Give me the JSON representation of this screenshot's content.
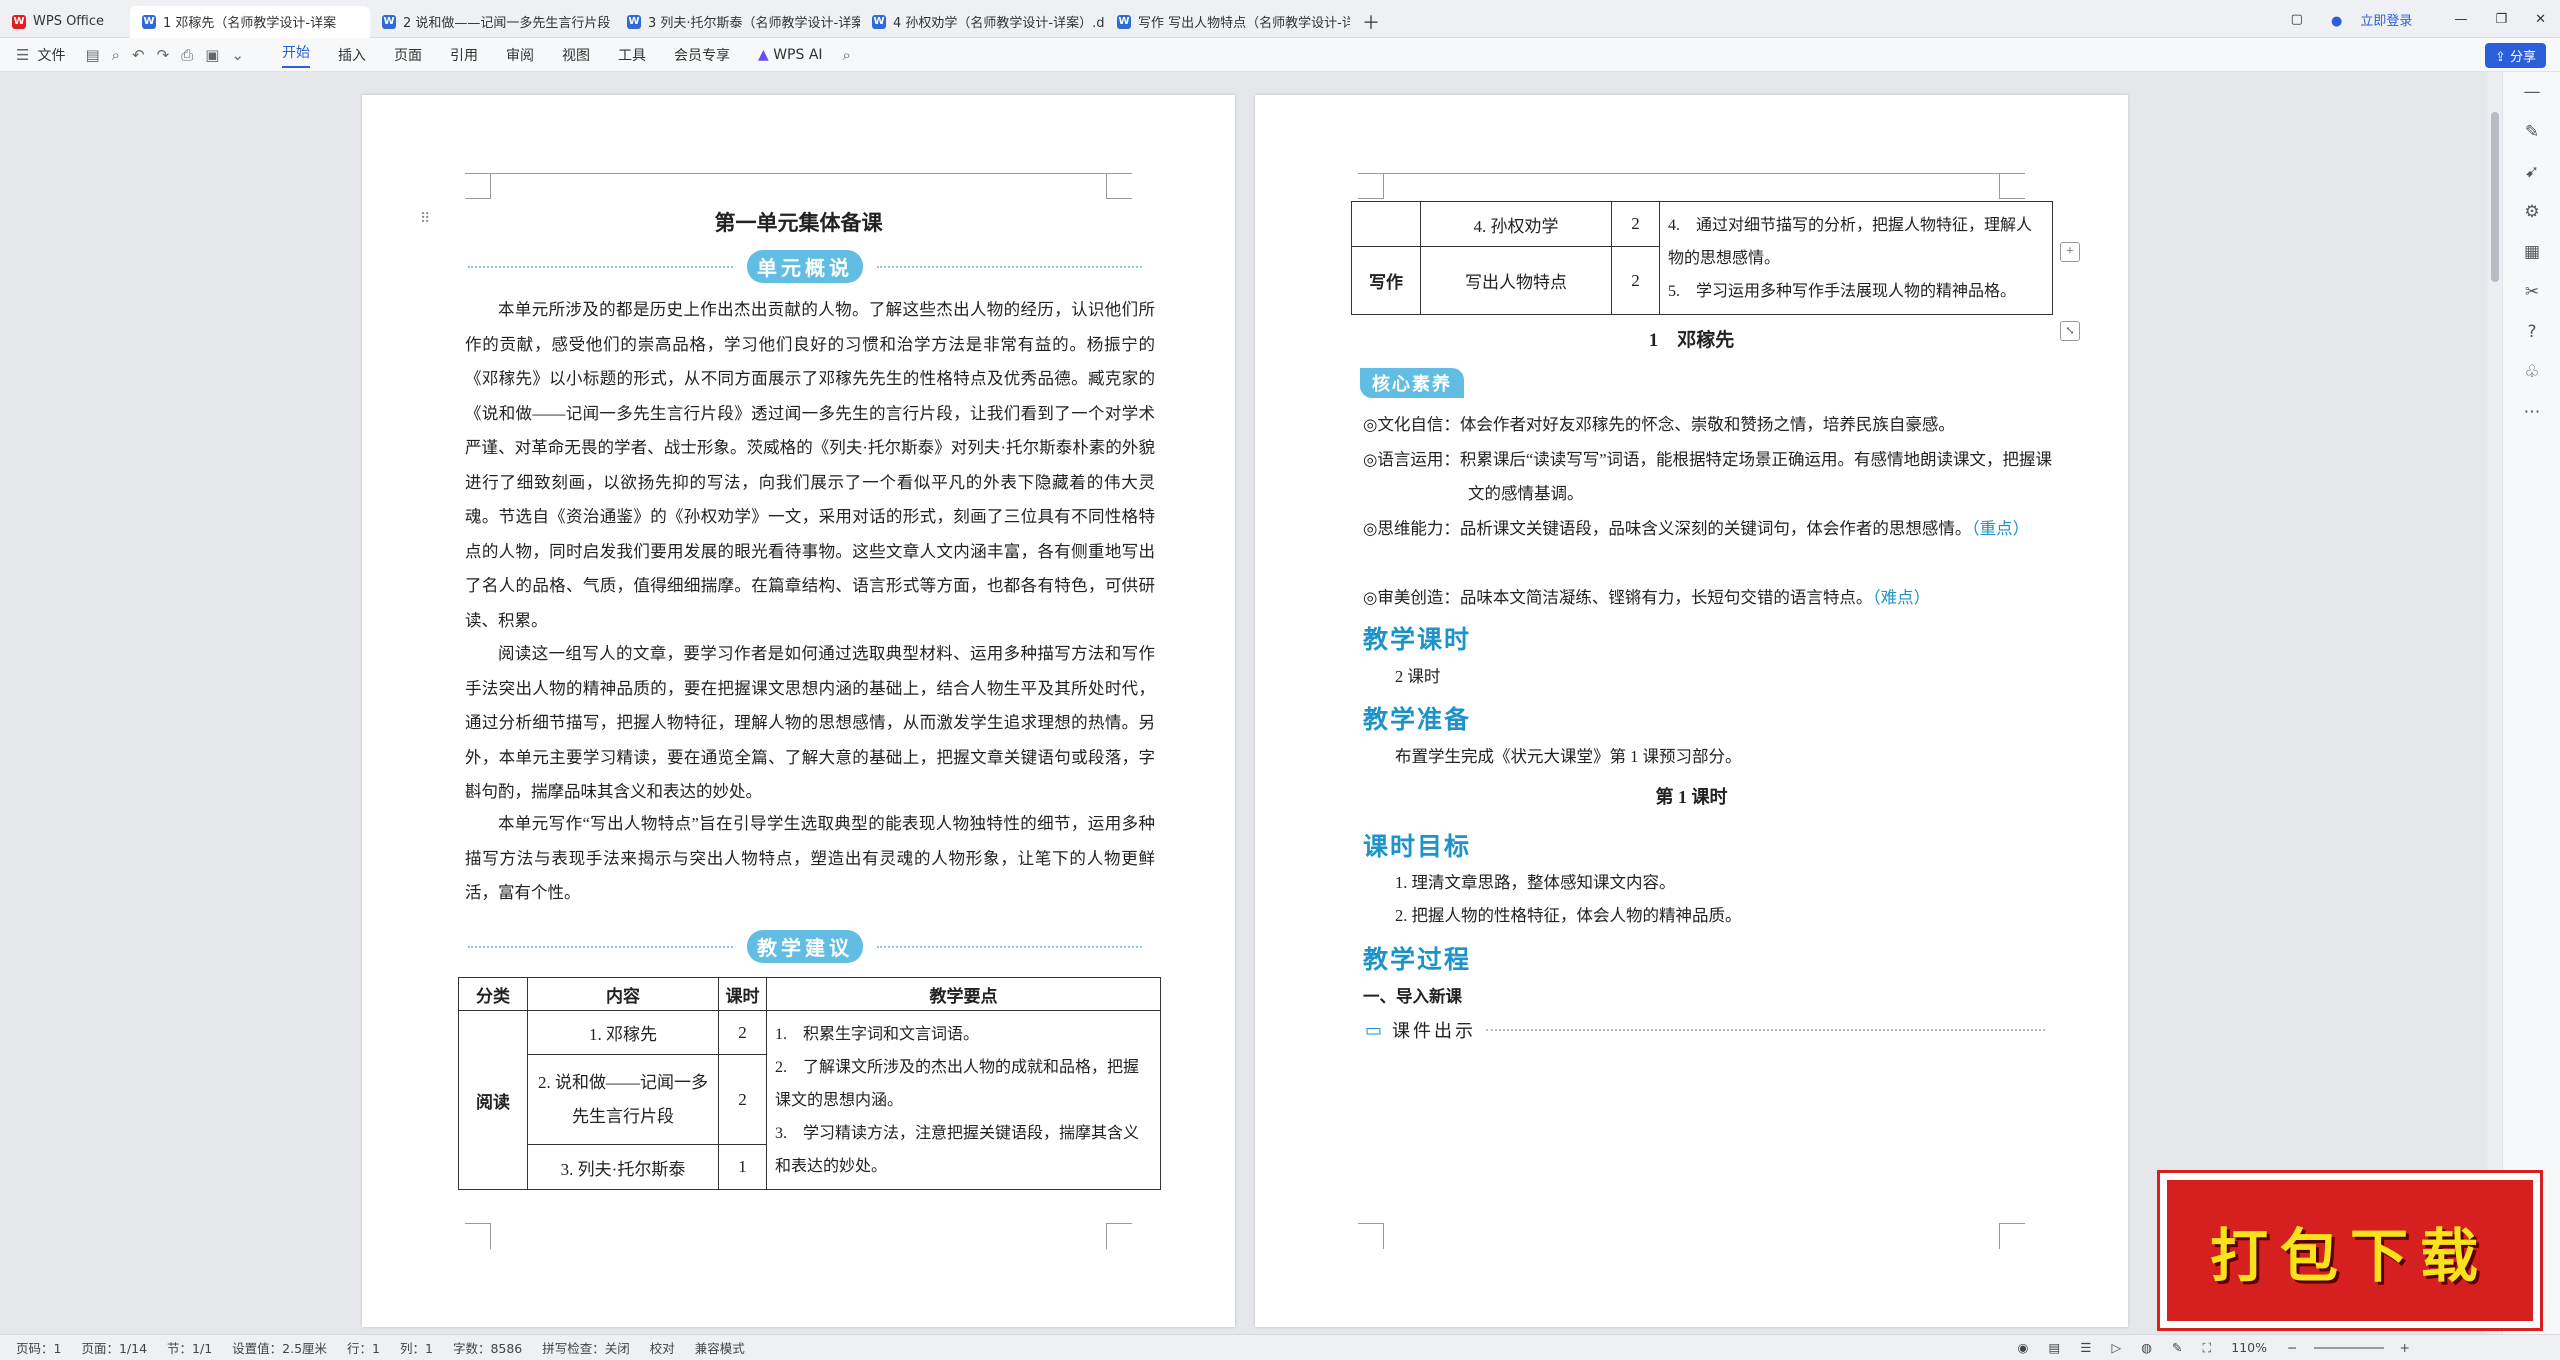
{
  "titlebar": {
    "tabs": [
      {
        "icon": "wps",
        "label": "WPS Office"
      },
      {
        "icon": "w",
        "label": "1 邓稼先（名师教学设计-详案"
      },
      {
        "icon": "w",
        "label": "2 说和做——记闻一多先生言行片段"
      },
      {
        "icon": "w",
        "label": "3 列夫·托尔斯泰（名师教学设计-详案）"
      },
      {
        "icon": "w",
        "label": "4 孙权劝学（名师教学设计-详案）.do"
      },
      {
        "icon": "w",
        "label": "写作 写出人物特点（名师教学设计-详"
      }
    ],
    "login": "立即登录"
  },
  "ribbon": {
    "file": "文件",
    "menus": [
      "开始",
      "插入",
      "页面",
      "引用",
      "审阅",
      "视图",
      "工具",
      "会员专享"
    ],
    "ai": "WPS AI",
    "share": "分享"
  },
  "left_page": {
    "title": "第一单元集体备课",
    "overview_head": "单元概说",
    "paragraphs": [
      "本单元所涉及的都是历史上作出杰出贡献的人物。了解这些杰出人物的经历，认识他们所作的贡献，感受他们的崇高品格，学习他们良好的习惯和治学方法是非常有益的。杨振宁的《邓稼先》以小标题的形式，从不同方面展示了邓稼先先生的性格特点及优秀品德。臧克家的《说和做——记闻一多先生言行片段》透过闻一多先生的言行片段，让我们看到了一个对学术严谨、对革命无畏的学者、战士形象。茨威格的《列夫·托尔斯泰》对列夫·托尔斯泰朴素的外貌进行了细致刻画，以欲扬先抑的写法，向我们展示了一个看似平凡的外表下隐藏着的伟大灵魂。节选自《资治通鉴》的《孙权劝学》一文，采用对话的形式，刻画了三位具有不同性格特点的人物，同时启发我们要用发展的眼光看待事物。这些文章人文内涵丰富，各有侧重地写出了名人的品格、气质，值得细细揣摩。在篇章结构、语言形式等方面，也都各有特色，可供研读、积累。",
      "阅读这一组写人的文章，要学习作者是如何通过选取典型材料、运用多种描写方法和写作手法突出人物的精神品质的，要在把握课文思想内涵的基础上，结合人物生平及其所处时代，通过分析细节描写，把握人物特征，理解人物的思想感情，从而激发学生追求理想的热情。另外，本单元主要学习精读，要在通览全篇、了解大意的基础上，把握文章关键语句或段落，字斟句酌，揣摩品味其含义和表达的妙处。",
      "本单元写作“写出人物特点”旨在引导学生选取典型的能表现人物独特性的细节，运用多种描写方法与表现手法来揭示与突出人物特点，塑造出有灵魂的人物形象，让笔下的人物更鲜活，富有个性。"
    ],
    "advice_head": "教学建议",
    "table": {
      "headers": [
        "分类",
        "内容",
        "课时",
        "教学要点"
      ],
      "category": "阅读",
      "rows": [
        {
          "content": "1. 邓稼先",
          "hours": "2"
        },
        {
          "content": "2. 说和做——记闻一多先生言行片段",
          "hours": "2"
        },
        {
          "content": "3. 列夫·托尔斯泰",
          "hours": "1"
        }
      ],
      "points": [
        "1.　积累生字词和文言词语。",
        "2.　了解课文所涉及的杰出人物的成就和品格，把握课文的思想内涵。",
        "3.　学习精读方法，注意把握关键语段，揣摩其含义和表达的妙处。"
      ]
    }
  },
  "right_page": {
    "table": {
      "rows": [
        {
          "category": "",
          "content": "4. 孙权劝学",
          "hours": "2"
        },
        {
          "category": "写作",
          "content": "写出人物特点",
          "hours": "2"
        }
      ],
      "points": [
        "4.　通过对细节描写的分析，把握人物特征，理解人物的思想感情。",
        "5.　学习运用多种写作手法展现人物的精神品格。"
      ]
    },
    "lesson_title": "1　邓稼先",
    "core_badge": "核心素养",
    "core_items": [
      {
        "text": "◎文化自信：体会作者对好友邓稼先的怀念、崇敬和赞扬之情，培养民族自豪感。",
        "note": ""
      },
      {
        "text": "◎语言运用：积累课后“读读写写”词语，能根据特定场景正确运用。有感情地朗读课文，把握课文的感情基调。",
        "note": ""
      },
      {
        "text": "◎思维能力：品析课文关键语段，品味含义深刻的关键词句，体会作者的思想感情。",
        "note": "（重点）"
      },
      {
        "text": "◎审美创造：品味本文简洁凝练、铿锵有力，长短句交错的语言特点。",
        "note": "（难点）"
      }
    ],
    "hours_head": "教学课时",
    "hours_text": "2 课时",
    "prep_head": "教学准备",
    "prep_text": "布置学生完成《状元大课堂》第 1 课预习部分。",
    "first_lesson": "第 1 课时",
    "goal_head": "课时目标",
    "goals": [
      "1. 理清文章思路，整体感知课文内容。",
      "2. 把握人物的性格特征，体会人物的精神品质。"
    ],
    "process_head": "教学过程",
    "step1": "一、导入新课",
    "courseware": "课件出示"
  },
  "status": [
    "页码：1",
    "页面：1/14",
    "节：1/1",
    "设置值：2.5厘米",
    "行：1",
    "列：1",
    "字数：8586",
    "拼写检查：关闭",
    "校对",
    "兼容模式"
  ],
  "zoom": "110%",
  "banner": "打包下载"
}
